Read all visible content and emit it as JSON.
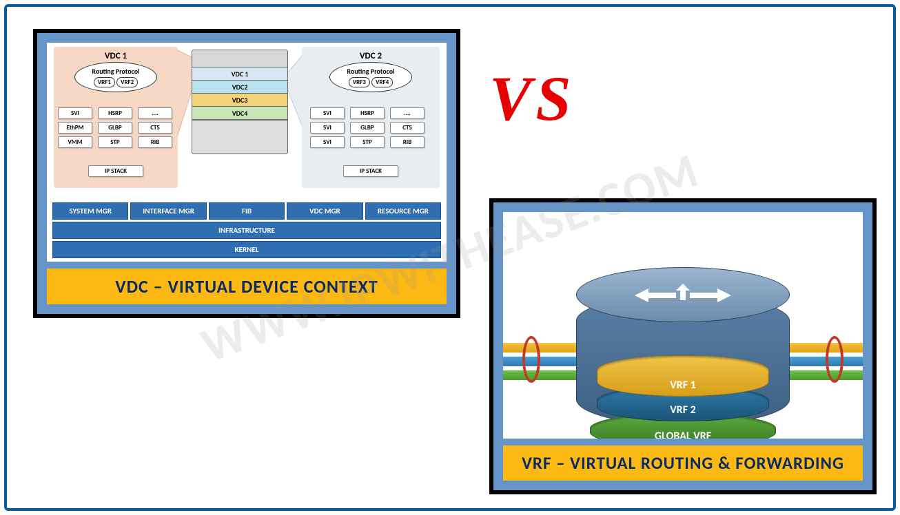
{
  "watermark": "WWW.IPWITHEASE.COM",
  "vs_label": "VS",
  "left_panel": {
    "caption": "VDC – VIRTUAL DEVICE CONTEXT",
    "vdc1": {
      "title": "VDC 1",
      "routing_label": "Routing Protocol",
      "vrfs": [
        "VRF1",
        "VRF2"
      ],
      "services": [
        "SVI",
        "HSRP",
        "....",
        "EthPM",
        "GLBP",
        "CTS",
        "VMM",
        "STP",
        "RIB"
      ],
      "ip_stack": "IP STACK"
    },
    "vdc2": {
      "title": "VDC 2",
      "routing_label": "Routing Protocol",
      "vrfs": [
        "VRF3",
        "VRF4"
      ],
      "services_left": [
        "SVI",
        "SVI",
        "SVI"
      ],
      "services_mid": [
        "HSRP",
        "GLBP",
        "STP"
      ],
      "services_right": [
        "....",
        "CTS",
        "RIB"
      ],
      "ip_stack": "IP STACK"
    },
    "chassis_slots": [
      "VDC 1",
      "VDC2",
      "VDC3",
      "VDC4"
    ],
    "row_cells": [
      "SYSTEM MGR",
      "INTERFACE MGR",
      "FIB",
      "VDC MGR",
      "RESOURCE MGR"
    ],
    "row_infra": "INFRASTRUCTURE",
    "row_kernel": "KERNEL",
    "chassis_slot_colors": [
      "#d9e7f5",
      "#b9e2ef",
      "#f4d47a",
      "#c9e7b6"
    ]
  },
  "right_panel": {
    "caption": "VRF – VIRTUAL ROUTING & FORWARDING",
    "disc_labels": [
      "VRF 1",
      "VRF 2",
      "GLOBAL VRF"
    ]
  }
}
